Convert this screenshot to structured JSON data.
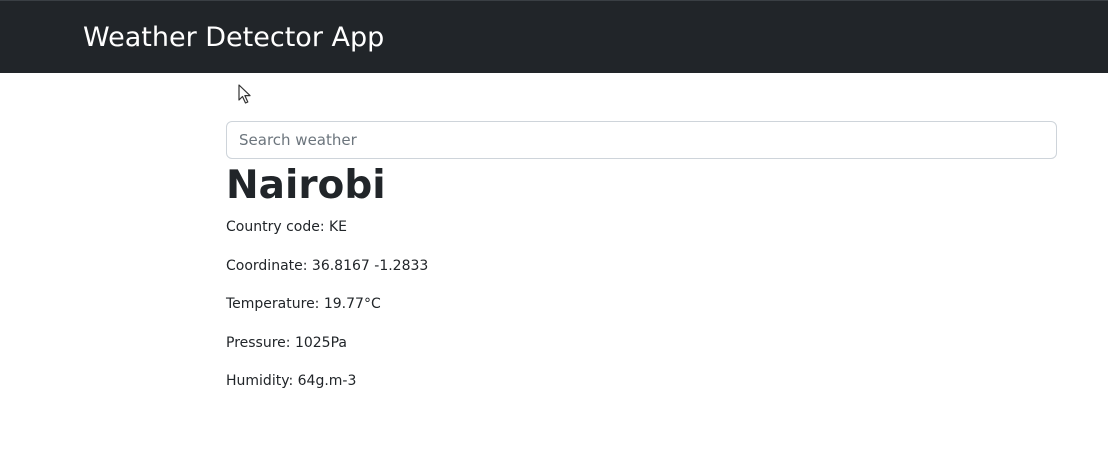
{
  "navbar": {
    "brand": "Weather Detector App"
  },
  "search": {
    "placeholder": "Search weather",
    "value": ""
  },
  "weather": {
    "city": "Nairobi",
    "rows": [
      {
        "label": "Country code: ",
        "value": "KE"
      },
      {
        "label": "Coordinate: ",
        "value": "36.8167 -1.2833"
      },
      {
        "label": "Temperature: ",
        "value": "19.77°C"
      },
      {
        "label": "Pressure: ",
        "value": "1025Pa"
      },
      {
        "label": "Humidity: ",
        "value": "64g.m-3"
      }
    ]
  },
  "icons": {
    "cursor": "mouse-pointer-icon"
  }
}
